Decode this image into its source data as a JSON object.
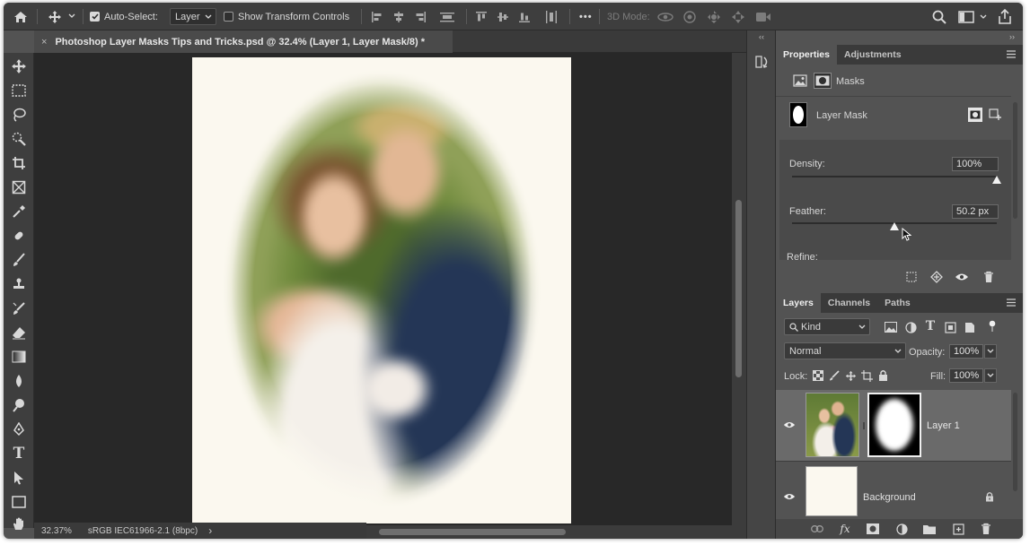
{
  "options_bar": {
    "auto_select_label": "Auto-Select:",
    "auto_select_target": "Layer",
    "show_transform_label": "Show Transform Controls",
    "mode_3d_label": "3D Mode:",
    "more_label": "•••"
  },
  "document": {
    "tab_title": "Photoshop Layer Masks Tips and Tricks.psd @ 32.4% (Layer 1, Layer Mask/8) *"
  },
  "status_bar": {
    "zoom": "32.37%",
    "color_profile": "sRGB IEC61966-2.1 (8bpc)",
    "arrow": "›"
  },
  "properties_panel": {
    "tabs": [
      "Properties",
      "Adjustments"
    ],
    "active_tab": "Properties",
    "section_label": "Masks",
    "mask_label": "Layer Mask",
    "density_label": "Density:",
    "density_value": "100%",
    "density_fraction": 1.0,
    "feather_label": "Feather:",
    "feather_value": "50.2 px",
    "feather_fraction": 0.5,
    "refine_label": "Refine:"
  },
  "layers_panel": {
    "tabs": [
      "Layers",
      "Channels",
      "Paths"
    ],
    "active_tab": "Layers",
    "filter_kind": "Kind",
    "blend_mode": "Normal",
    "opacity_label": "Opacity:",
    "opacity_value": "100%",
    "lock_label": "Lock:",
    "fill_label": "Fill:",
    "fill_value": "100%",
    "layers": [
      {
        "name": "Layer 1",
        "visible": true,
        "selected": true,
        "has_mask": true
      },
      {
        "name": "Background",
        "visible": true,
        "selected": false,
        "locked": true
      }
    ]
  },
  "colors": {
    "app_bg": "#535353",
    "bar_bg": "#3e3e3e",
    "canvas_bg": "#282828",
    "document_bg": "#fbf8ef",
    "selected_layer": "#6a6a6a"
  }
}
